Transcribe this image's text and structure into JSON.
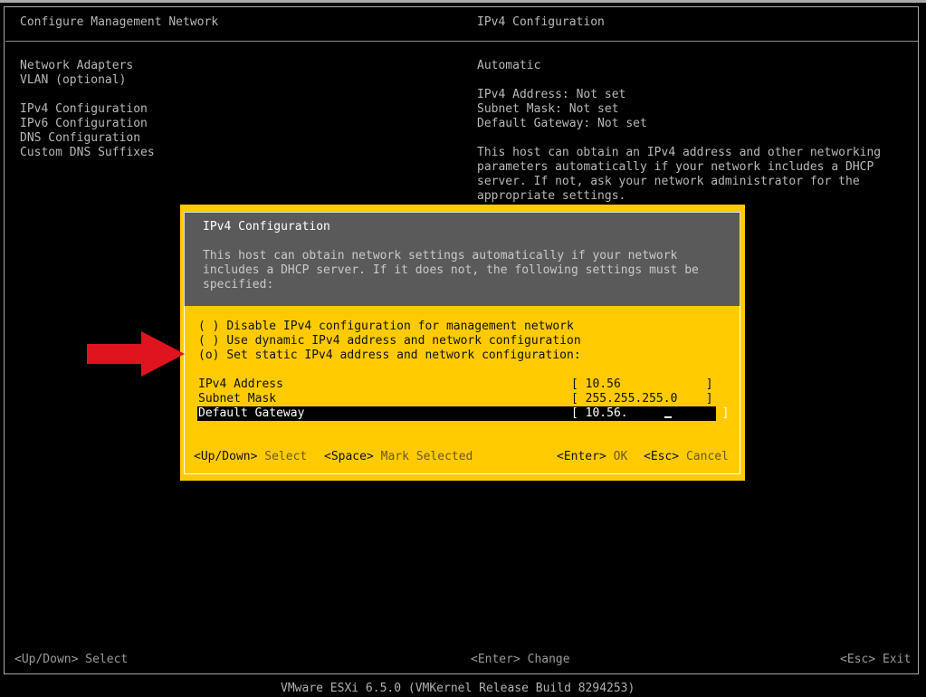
{
  "header": {
    "left_title": "Configure Management Network",
    "right_title": "IPv4 Configuration"
  },
  "menu": {
    "items": [
      {
        "label": "Network Adapters"
      },
      {
        "label": "VLAN (optional)"
      },
      {
        "label": "IPv4 Configuration"
      },
      {
        "label": "IPv6 Configuration"
      },
      {
        "label": "DNS Configuration"
      },
      {
        "label": "Custom DNS Suffixes"
      }
    ]
  },
  "info": {
    "mode": "Automatic",
    "ipv4_address": "IPv4 Address: Not set",
    "subnet_mask": "Subnet Mask: Not set",
    "default_gateway": "Default Gateway: Not set",
    "description_lines": [
      "This host can obtain an IPv4 address and other networking",
      "parameters automatically if your network includes a DHCP",
      "server. If not, ask your network administrator for the",
      "appropriate settings."
    ]
  },
  "dialog": {
    "title": "IPv4 Configuration",
    "description_lines": [
      "This host can obtain network settings automatically if your network",
      "includes a DHCP server. If it does not, the following settings must be",
      "specified:"
    ],
    "options": [
      {
        "marker": "( )",
        "label": "Disable IPv4 configuration for management network",
        "selected": false
      },
      {
        "marker": "( )",
        "label": "Use dynamic IPv4 address and network configuration",
        "selected": false
      },
      {
        "marker": "(o)",
        "label": "Set static IPv4 address and network configuration:",
        "selected": true
      }
    ],
    "fields": [
      {
        "label": "IPv4 Address",
        "value": "[ 10.56            ]"
      },
      {
        "label": "Subnet Mask",
        "value": "[ 255.255.255.0    ]"
      },
      {
        "label": "Default Gateway",
        "value": "[ 10.56.",
        "value_end": "]",
        "focused": true
      }
    ],
    "keys": {
      "updown_key": "<Up/Down>",
      "updown_hint": "Select",
      "space_key": "<Space>",
      "space_hint": "Mark Selected",
      "enter_key": "<Enter>",
      "enter_hint": "OK",
      "esc_key": "<Esc>",
      "esc_hint": "Cancel"
    }
  },
  "footer": {
    "left": "<Up/Down> Select",
    "middle": "<Enter> Change",
    "right": "<Esc> Exit"
  },
  "version_line": "VMware ESXi 6.5.0 (VMKernel Release Build 8294253)",
  "colors": {
    "background": "#000000",
    "dialog_accent": "#ffcb00",
    "dialog_header": "#5a5a5a",
    "annotation_arrow": "#e0141e"
  },
  "annotation": {
    "icon": "red-arrow-icon"
  }
}
